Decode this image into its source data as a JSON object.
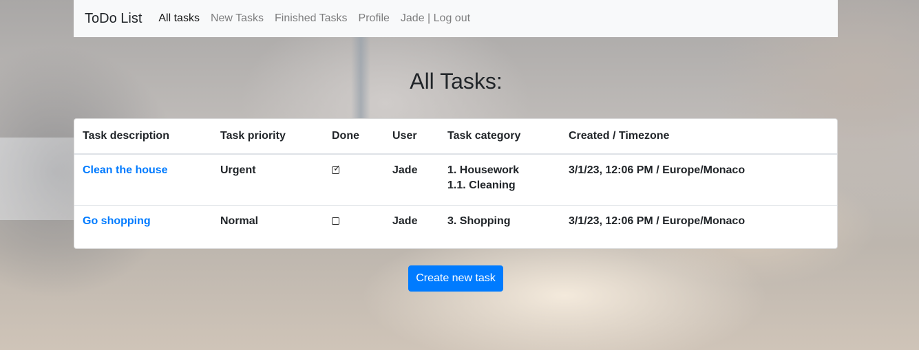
{
  "navbar": {
    "brand": "ToDo List",
    "links": [
      "All tasks",
      "New Tasks",
      "Finished Tasks",
      "Profile",
      "Jade | Log out"
    ]
  },
  "page_title": "All Tasks:",
  "table": {
    "headers": [
      "Task description",
      "Task priority",
      "Done",
      "User",
      "Task category",
      "Created / Timezone"
    ],
    "rows": [
      {
        "description": "Clean the house",
        "priority": "Urgent",
        "done": true,
        "user": "Jade",
        "category_line1": "1. Housework",
        "category_line2": "1.1. Cleaning",
        "created": "3/1/23, 12:06 PM / Europe/Monaco"
      },
      {
        "description": "Go shopping",
        "priority": "Normal",
        "done": false,
        "user": "Jade",
        "category_line1": "3. Shopping",
        "created": "3/1/23, 12:06 PM / Europe/Monaco"
      }
    ]
  },
  "create_button": "Create new task",
  "colors": {
    "primary": "#007bff",
    "navbar_bg": "#f8f9fa"
  }
}
